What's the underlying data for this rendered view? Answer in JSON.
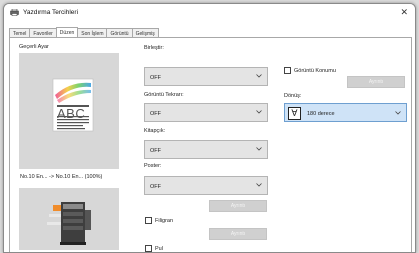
{
  "window": {
    "title": "Yazdırma Tercihleri",
    "close_glyph": "✕",
    "title_icon": "printer-icon"
  },
  "tabs": [
    {
      "label": "Temel",
      "active": false
    },
    {
      "label": "Favoriler",
      "active": false
    },
    {
      "label": "Düzen",
      "active": true
    },
    {
      "label": "Son İşlem",
      "active": false
    },
    {
      "label": "Görüntü",
      "active": false
    },
    {
      "label": "Gelişmiş",
      "active": false
    }
  ],
  "preview": {
    "heading": "Geçerli Ayar",
    "page_text": "ABC",
    "status": "No.10 En... -> No.10 En... (100%)"
  },
  "fields": {
    "combine": {
      "label": "Birleştir:",
      "value": "OFF"
    },
    "image_repeat": {
      "label": "Görüntü Tekrarı:",
      "value": "OFF"
    },
    "booklet": {
      "label": "Kitapçık:",
      "value": "OFF"
    },
    "poster": {
      "label": "Poster:",
      "value": "OFF"
    }
  },
  "buttons": {
    "details": "Ayrıntı"
  },
  "checkboxes": {
    "image_position": {
      "label": "Görüntü Konumu",
      "checked": false
    },
    "watermark": {
      "label": "Filigran",
      "checked": false
    },
    "stamp": {
      "label": "Pul",
      "checked": false
    }
  },
  "rotation": {
    "label": "Dönüş:",
    "value": "180 derece",
    "icon": "rotation-glyph-icon"
  },
  "colors": {
    "selected_tab_bg": "#ffffff",
    "rotation_bg": "#cfe3f7",
    "rotation_border": "#6e9fd0",
    "disabled_button": "#d0d0d0"
  }
}
